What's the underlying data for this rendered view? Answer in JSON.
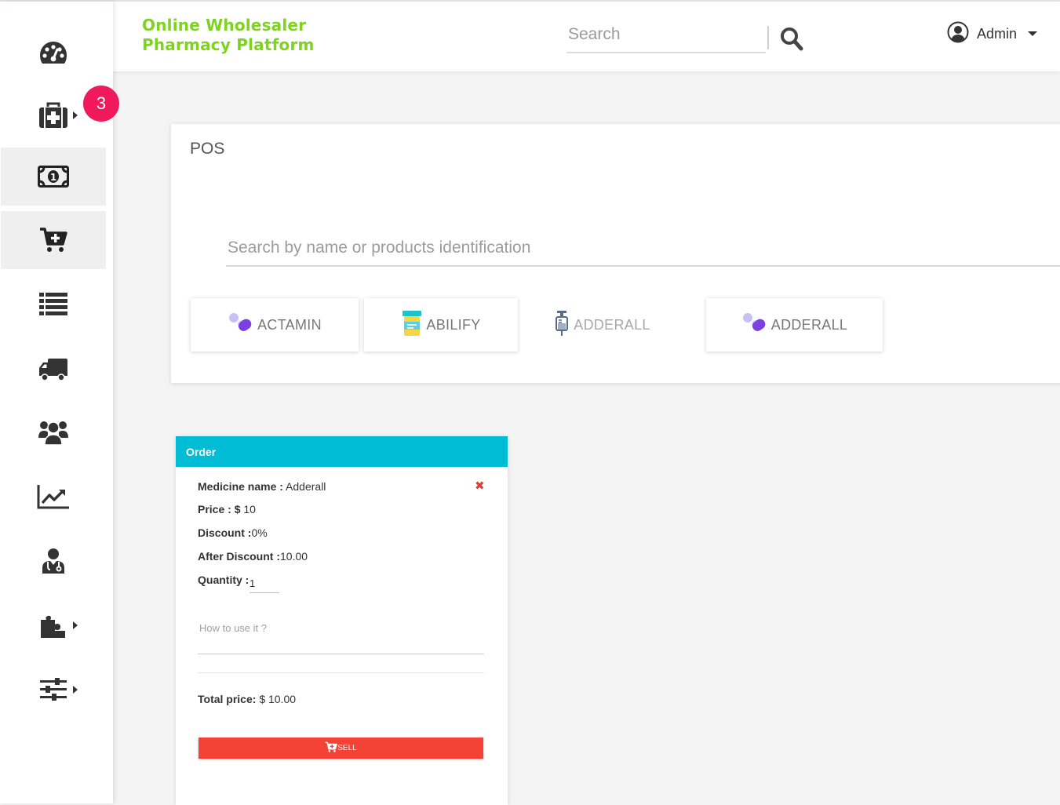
{
  "header": {
    "brand_line1": "Online Wholesaler",
    "brand_line2": "Pharmacy Platform",
    "search_placeholder": "Search",
    "user_name": "Admin"
  },
  "sidebar": {
    "badge_count": "3",
    "items": [
      {
        "icon": "dashboard-icon"
      },
      {
        "icon": "medical-kit-icon",
        "has_submenu": true
      },
      {
        "icon": "money-bill-icon",
        "active": true
      },
      {
        "icon": "cart-plus-icon",
        "active": true
      },
      {
        "icon": "list-icon"
      },
      {
        "icon": "truck-icon"
      },
      {
        "icon": "users-icon"
      },
      {
        "icon": "chart-line-icon"
      },
      {
        "icon": "doctor-icon"
      },
      {
        "icon": "puzzle-icon",
        "has_submenu": true
      },
      {
        "icon": "sliders-icon",
        "has_submenu": true
      }
    ]
  },
  "pos": {
    "title": "POS",
    "search_placeholder": "Search by name or products identification",
    "products": [
      {
        "name": "ACTAMIN",
        "icon": "pills-icon"
      },
      {
        "name": "ABILIFY",
        "icon": "pill-bottle-icon"
      },
      {
        "name": "ADDERALL",
        "icon": "syringe-icon"
      },
      {
        "name": "ADDERALL",
        "icon": "pills-icon"
      }
    ]
  },
  "order": {
    "title": "Order",
    "medicine_label": "Medicine name :",
    "medicine_value": "Adderall",
    "price_label": "Price :",
    "price_currency": "$",
    "price_value": "10",
    "discount_label": "Discount :",
    "discount_value": "0%",
    "after_discount_label": "After Discount :",
    "after_discount_value": "10.00",
    "quantity_label": "Quantity :",
    "quantity_value": "1",
    "howto_placeholder": "How to use it ?",
    "total_label": "Total price:",
    "total_value": "$ 10.00",
    "sell_label": "SELL"
  },
  "colors": {
    "brand": "#7ed321",
    "badge": "#f0195c",
    "order_header": "#00bcd4",
    "sell_button": "#f44336",
    "remove": "#e53935"
  }
}
